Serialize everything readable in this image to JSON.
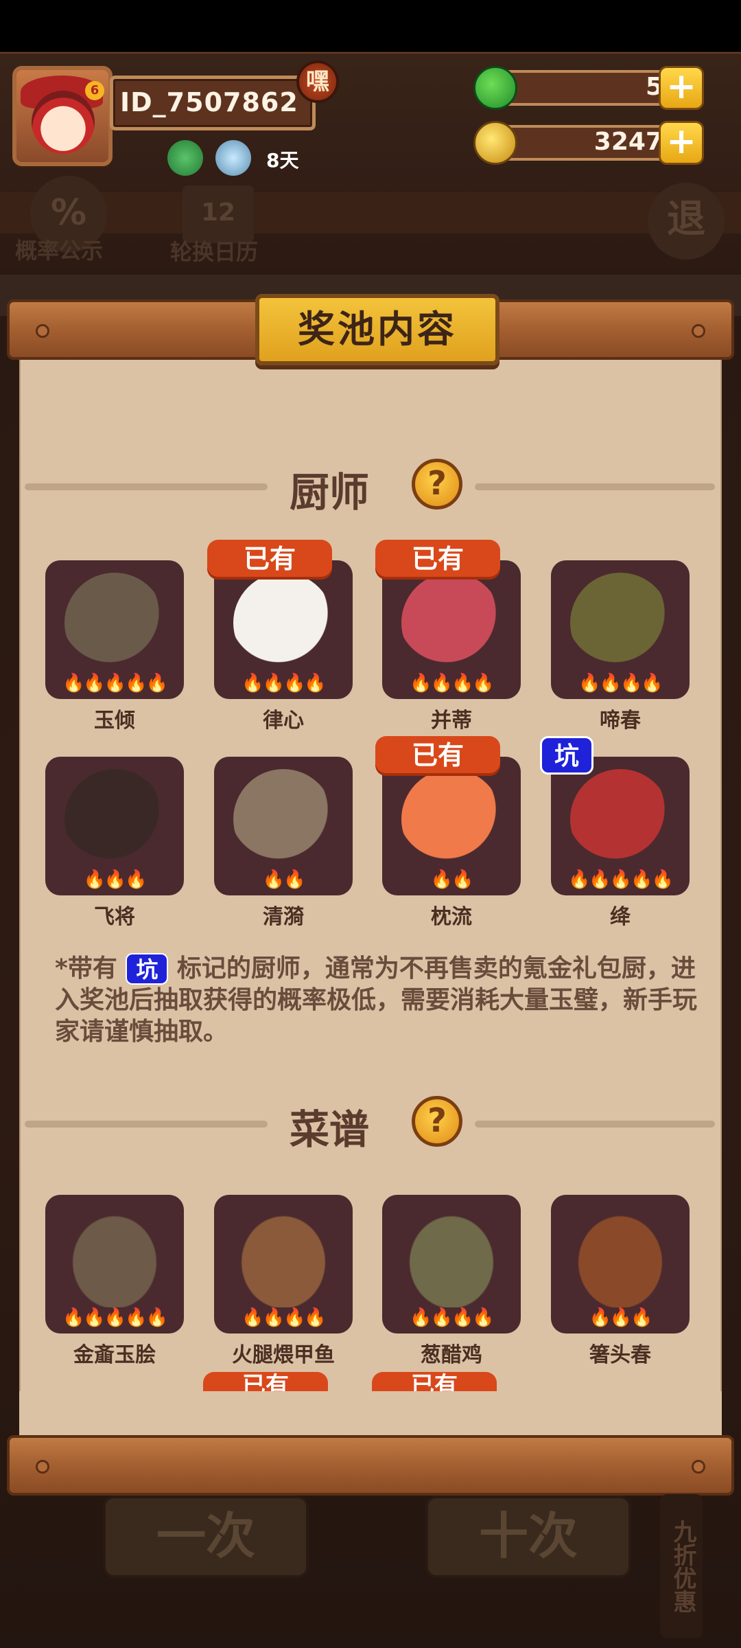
{
  "header": {
    "player_id": "ID_7507862",
    "hey_badge": "嘿",
    "days": "8天",
    "jade_count": "5",
    "coin_count": "3247",
    "plus": "+"
  },
  "background": {
    "probability_label": "概率公示",
    "probability_symbol": "%",
    "calendar_label": "轮换日历",
    "calendar_num": "12",
    "exit_label": "退"
  },
  "panel": {
    "title": "奖池内容"
  },
  "chefs": {
    "section_title": "厨师",
    "help": "?",
    "items": [
      {
        "name": "玉倾",
        "flames": "🔥🔥🔥🔥🔥",
        "tag": "",
        "art": "#6a5a4a"
      },
      {
        "name": "律心",
        "flames": "🔥🔥🔥🔥",
        "tag": "已有",
        "art": "#f4f1ec"
      },
      {
        "name": "并蒂",
        "flames": "🔥🔥🔥🔥",
        "tag": "已有",
        "art": "#c84a58"
      },
      {
        "name": "啼春",
        "flames": "🔥🔥🔥🔥",
        "tag": "",
        "art": "#6b6535"
      },
      {
        "name": "飞将",
        "flames": "🔥🔥🔥",
        "tag": "",
        "art": "#3a2826"
      },
      {
        "name": "清漪",
        "flames": "🔥🔥",
        "tag": "",
        "art": "#8b7563"
      },
      {
        "name": "枕流",
        "flames": "🔥🔥",
        "tag": "已有",
        "art": "#f07a4a"
      },
      {
        "name": "绛",
        "flames": "🔥🔥🔥🔥🔥",
        "tag": "坑",
        "art": "#b53232"
      }
    ]
  },
  "note": {
    "prefix": "*带有",
    "pit": "坑",
    "text": "标记的厨师，通常为不再售卖的氪金礼包厨，进入奖池后抽取获得的概率极低，需要消耗大量玉璧，新手玩家请谨慎抽取。"
  },
  "recipes": {
    "section_title": "菜谱",
    "help": "?",
    "items": [
      {
        "name": "金齑玉脍",
        "flames": "🔥🔥🔥🔥🔥",
        "art": "#6d5a48"
      },
      {
        "name": "火腿煨甲鱼",
        "flames": "🔥🔥🔥🔥",
        "art": "#8a5a3a"
      },
      {
        "name": "葱醋鸡",
        "flames": "🔥🔥🔥🔥",
        "art": "#6f6a4a"
      },
      {
        "name": "箸头春",
        "flames": "🔥🔥🔥",
        "art": "#8a4a2a"
      }
    ],
    "next_tags": [
      "已有",
      "已有"
    ]
  },
  "bottom": {
    "single_draw": "一次",
    "ten_draw": "十次",
    "discount": "九折优惠"
  }
}
